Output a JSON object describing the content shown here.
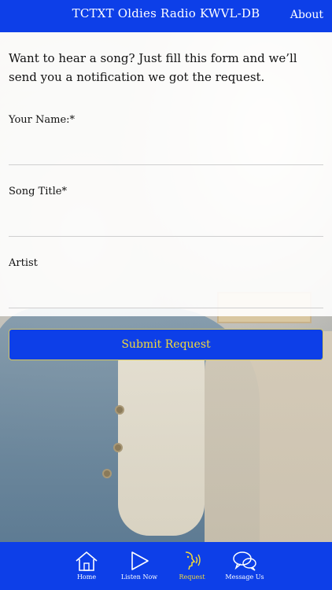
{
  "header": {
    "title": "TCTXT Oldies Radio KWVL-DB",
    "about_label": "About"
  },
  "form": {
    "intro": "Want to hear a song? Just fill this form and we’ll send you a notification we got the request.",
    "fields": [
      {
        "label": "Your Name:*",
        "value": ""
      },
      {
        "label": "Song Title*",
        "value": ""
      },
      {
        "label": "Artist",
        "value": ""
      }
    ],
    "submit_label": "Submit Request"
  },
  "tabbar": {
    "items": [
      {
        "label": "Home",
        "icon": "home-icon"
      },
      {
        "label": "Listen Now",
        "icon": "play-icon"
      },
      {
        "label": "Request",
        "icon": "request-icon",
        "active": true
      },
      {
        "label": "Message Us",
        "icon": "chat-icon"
      }
    ]
  },
  "colors": {
    "brand": "#0d3fe8",
    "accent": "#f2d93b"
  }
}
